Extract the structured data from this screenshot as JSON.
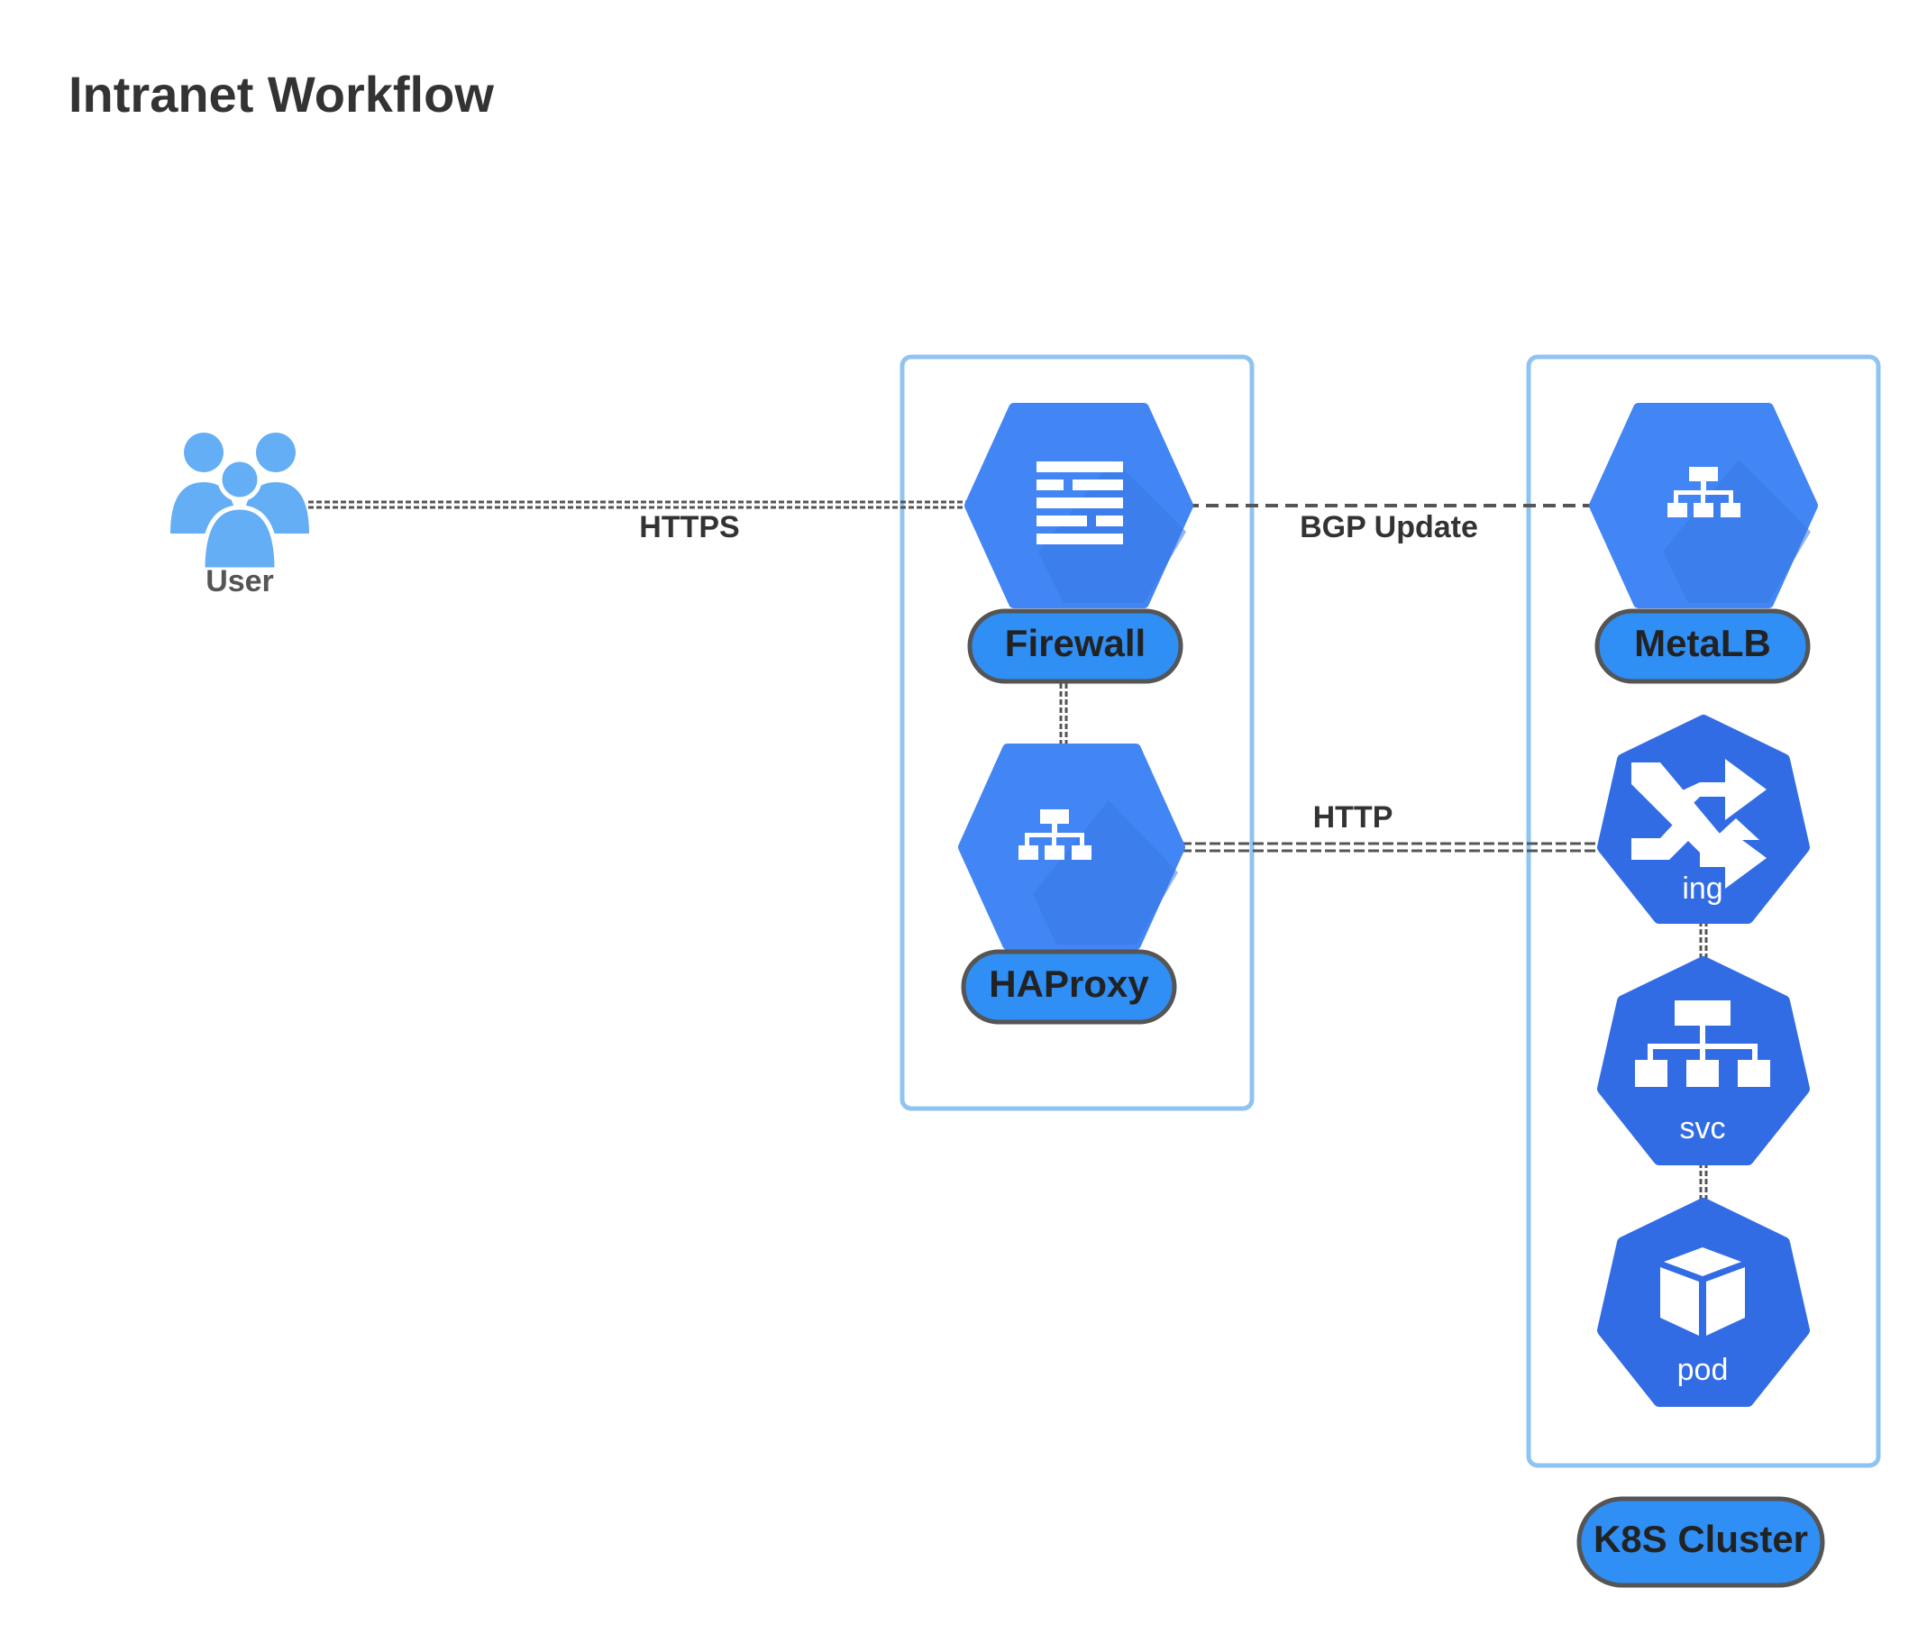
{
  "title": "Intranet Workflow",
  "colors": {
    "hex_blue": "#4285f4",
    "hex_shadow": "#3b78e7",
    "k8s_blue": "#326ce5",
    "pill_fill": "#2f8ff5",
    "pill_border": "#555555",
    "group_border": "#90c4f0",
    "user_blue": "#64aef5",
    "line": "#555555",
    "text_dark": "#333333"
  },
  "nodes": {
    "user": {
      "label": "User",
      "icon": "users-icon"
    },
    "firewall": {
      "label": "Firewall",
      "icon": "firewall-icon"
    },
    "haproxy": {
      "label": "HAProxy",
      "icon": "load-balancer-icon"
    },
    "metallb": {
      "label": "MetaLB",
      "icon": "load-balancer-icon"
    },
    "ing": {
      "label": "ing",
      "icon": "ingress-shuffle-icon"
    },
    "svc": {
      "label": "svc",
      "icon": "service-tree-icon"
    },
    "pod": {
      "label": "pod",
      "icon": "pod-cube-icon"
    }
  },
  "edges": {
    "user_firewall": {
      "label": "HTTPS"
    },
    "firewall_metallb": {
      "label": "BGP Update"
    },
    "haproxy_ing": {
      "label": "HTTP"
    },
    "firewall_haproxy": {
      "label": ""
    },
    "ing_svc": {
      "label": ""
    },
    "svc_pod": {
      "label": ""
    }
  },
  "groups": {
    "k8s_cluster": {
      "label": "K8S Cluster"
    }
  }
}
